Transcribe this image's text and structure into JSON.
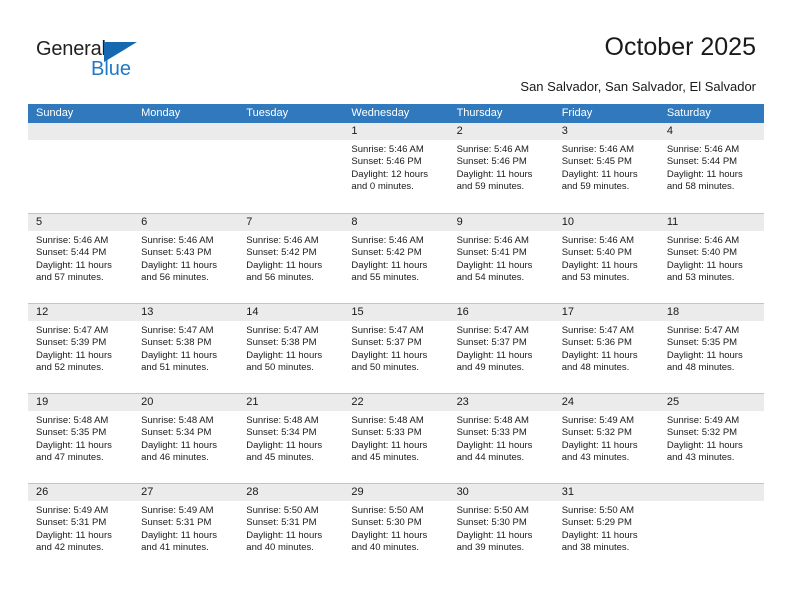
{
  "logo": {
    "primary_text": "General",
    "secondary_text": "Blue",
    "primary_color": "#231f20",
    "secondary_color": "#2079c7",
    "triangle_color": "#1569b0"
  },
  "header": {
    "title": "October 2025",
    "subtitle": "San Salvador, San Salvador, El Salvador"
  },
  "theme": {
    "header_row_bg": "#3079bd",
    "header_row_text": "#ffffff",
    "day_band_bg": "#ebebeb",
    "grid_line": "#b5c7d8",
    "body_text": "#1a1a1a"
  },
  "weekdays": [
    "Sunday",
    "Monday",
    "Tuesday",
    "Wednesday",
    "Thursday",
    "Friday",
    "Saturday"
  ],
  "weeks": [
    [
      {
        "day": "",
        "lines": []
      },
      {
        "day": "",
        "lines": []
      },
      {
        "day": "",
        "lines": []
      },
      {
        "day": "1",
        "lines": [
          "Sunrise: 5:46 AM",
          "Sunset: 5:46 PM",
          "Daylight: 12 hours",
          "and 0 minutes."
        ]
      },
      {
        "day": "2",
        "lines": [
          "Sunrise: 5:46 AM",
          "Sunset: 5:46 PM",
          "Daylight: 11 hours",
          "and 59 minutes."
        ]
      },
      {
        "day": "3",
        "lines": [
          "Sunrise: 5:46 AM",
          "Sunset: 5:45 PM",
          "Daylight: 11 hours",
          "and 59 minutes."
        ]
      },
      {
        "day": "4",
        "lines": [
          "Sunrise: 5:46 AM",
          "Sunset: 5:44 PM",
          "Daylight: 11 hours",
          "and 58 minutes."
        ]
      }
    ],
    [
      {
        "day": "5",
        "lines": [
          "Sunrise: 5:46 AM",
          "Sunset: 5:44 PM",
          "Daylight: 11 hours",
          "and 57 minutes."
        ]
      },
      {
        "day": "6",
        "lines": [
          "Sunrise: 5:46 AM",
          "Sunset: 5:43 PM",
          "Daylight: 11 hours",
          "and 56 minutes."
        ]
      },
      {
        "day": "7",
        "lines": [
          "Sunrise: 5:46 AM",
          "Sunset: 5:42 PM",
          "Daylight: 11 hours",
          "and 56 minutes."
        ]
      },
      {
        "day": "8",
        "lines": [
          "Sunrise: 5:46 AM",
          "Sunset: 5:42 PM",
          "Daylight: 11 hours",
          "and 55 minutes."
        ]
      },
      {
        "day": "9",
        "lines": [
          "Sunrise: 5:46 AM",
          "Sunset: 5:41 PM",
          "Daylight: 11 hours",
          "and 54 minutes."
        ]
      },
      {
        "day": "10",
        "lines": [
          "Sunrise: 5:46 AM",
          "Sunset: 5:40 PM",
          "Daylight: 11 hours",
          "and 53 minutes."
        ]
      },
      {
        "day": "11",
        "lines": [
          "Sunrise: 5:46 AM",
          "Sunset: 5:40 PM",
          "Daylight: 11 hours",
          "and 53 minutes."
        ]
      }
    ],
    [
      {
        "day": "12",
        "lines": [
          "Sunrise: 5:47 AM",
          "Sunset: 5:39 PM",
          "Daylight: 11 hours",
          "and 52 minutes."
        ]
      },
      {
        "day": "13",
        "lines": [
          "Sunrise: 5:47 AM",
          "Sunset: 5:38 PM",
          "Daylight: 11 hours",
          "and 51 minutes."
        ]
      },
      {
        "day": "14",
        "lines": [
          "Sunrise: 5:47 AM",
          "Sunset: 5:38 PM",
          "Daylight: 11 hours",
          "and 50 minutes."
        ]
      },
      {
        "day": "15",
        "lines": [
          "Sunrise: 5:47 AM",
          "Sunset: 5:37 PM",
          "Daylight: 11 hours",
          "and 50 minutes."
        ]
      },
      {
        "day": "16",
        "lines": [
          "Sunrise: 5:47 AM",
          "Sunset: 5:37 PM",
          "Daylight: 11 hours",
          "and 49 minutes."
        ]
      },
      {
        "day": "17",
        "lines": [
          "Sunrise: 5:47 AM",
          "Sunset: 5:36 PM",
          "Daylight: 11 hours",
          "and 48 minutes."
        ]
      },
      {
        "day": "18",
        "lines": [
          "Sunrise: 5:47 AM",
          "Sunset: 5:35 PM",
          "Daylight: 11 hours",
          "and 48 minutes."
        ]
      }
    ],
    [
      {
        "day": "19",
        "lines": [
          "Sunrise: 5:48 AM",
          "Sunset: 5:35 PM",
          "Daylight: 11 hours",
          "and 47 minutes."
        ]
      },
      {
        "day": "20",
        "lines": [
          "Sunrise: 5:48 AM",
          "Sunset: 5:34 PM",
          "Daylight: 11 hours",
          "and 46 minutes."
        ]
      },
      {
        "day": "21",
        "lines": [
          "Sunrise: 5:48 AM",
          "Sunset: 5:34 PM",
          "Daylight: 11 hours",
          "and 45 minutes."
        ]
      },
      {
        "day": "22",
        "lines": [
          "Sunrise: 5:48 AM",
          "Sunset: 5:33 PM",
          "Daylight: 11 hours",
          "and 45 minutes."
        ]
      },
      {
        "day": "23",
        "lines": [
          "Sunrise: 5:48 AM",
          "Sunset: 5:33 PM",
          "Daylight: 11 hours",
          "and 44 minutes."
        ]
      },
      {
        "day": "24",
        "lines": [
          "Sunrise: 5:49 AM",
          "Sunset: 5:32 PM",
          "Daylight: 11 hours",
          "and 43 minutes."
        ]
      },
      {
        "day": "25",
        "lines": [
          "Sunrise: 5:49 AM",
          "Sunset: 5:32 PM",
          "Daylight: 11 hours",
          "and 43 minutes."
        ]
      }
    ],
    [
      {
        "day": "26",
        "lines": [
          "Sunrise: 5:49 AM",
          "Sunset: 5:31 PM",
          "Daylight: 11 hours",
          "and 42 minutes."
        ]
      },
      {
        "day": "27",
        "lines": [
          "Sunrise: 5:49 AM",
          "Sunset: 5:31 PM",
          "Daylight: 11 hours",
          "and 41 minutes."
        ]
      },
      {
        "day": "28",
        "lines": [
          "Sunrise: 5:50 AM",
          "Sunset: 5:31 PM",
          "Daylight: 11 hours",
          "and 40 minutes."
        ]
      },
      {
        "day": "29",
        "lines": [
          "Sunrise: 5:50 AM",
          "Sunset: 5:30 PM",
          "Daylight: 11 hours",
          "and 40 minutes."
        ]
      },
      {
        "day": "30",
        "lines": [
          "Sunrise: 5:50 AM",
          "Sunset: 5:30 PM",
          "Daylight: 11 hours",
          "and 39 minutes."
        ]
      },
      {
        "day": "31",
        "lines": [
          "Sunrise: 5:50 AM",
          "Sunset: 5:29 PM",
          "Daylight: 11 hours",
          "and 38 minutes."
        ]
      },
      {
        "day": "",
        "lines": []
      }
    ]
  ]
}
